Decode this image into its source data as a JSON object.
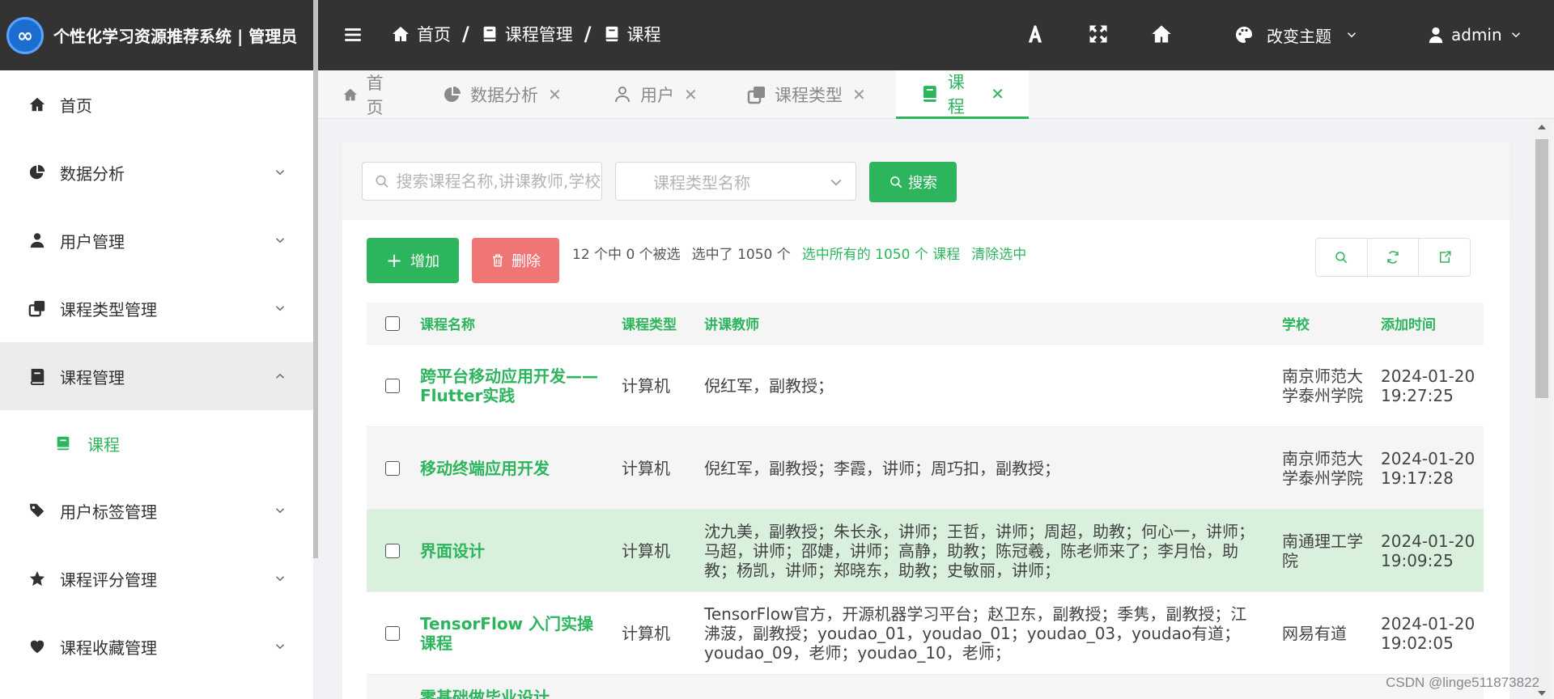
{
  "brand": {
    "title": "个性化学习资源推荐系统 | 管理员"
  },
  "sidebar": {
    "items": [
      {
        "label": "首页"
      },
      {
        "label": "数据分析"
      },
      {
        "label": "用户管理"
      },
      {
        "label": "课程类型管理"
      },
      {
        "label": "课程管理"
      },
      {
        "label": "课程"
      },
      {
        "label": "用户标签管理"
      },
      {
        "label": "课程评分管理"
      },
      {
        "label": "课程收藏管理"
      }
    ]
  },
  "header": {
    "breadcrumb": [
      "首页",
      "课程管理",
      "课程"
    ],
    "theme_label": "改变主题",
    "user_label": "admin"
  },
  "tabs": [
    {
      "label": "首页"
    },
    {
      "label": "数据分析"
    },
    {
      "label": "用户"
    },
    {
      "label": "课程类型"
    },
    {
      "label": "课程"
    }
  ],
  "filter": {
    "search_placeholder": "搜索课程名称,讲课教师,学校",
    "type_placeholder": "课程类型名称",
    "search_button": "搜索"
  },
  "toolbar": {
    "add_label": "增加",
    "delete_label": "删除",
    "selected_count": "12 个中 0 个被选",
    "selected_total": "选中了 1050 个",
    "select_all": "选中所有的 1050 个 课程",
    "clear_selection": "清除选中"
  },
  "table": {
    "headers": [
      "课程名称",
      "课程类型",
      "讲课教师",
      "学校",
      "添加时间"
    ],
    "rows": [
      {
        "name": "跨平台移动应用开发——Flutter实践",
        "type": "计算机",
        "teacher": "倪红军，副教授；",
        "school": "南京师范大学泰州学院",
        "time": "2024-01-20 19:27:25"
      },
      {
        "name": "移动终端应用开发",
        "type": "计算机",
        "teacher": "倪红军，副教授；李霞，讲师；周巧扣，副教授；",
        "school": "南京师范大学泰州学院",
        "time": "2024-01-20 19:17:28"
      },
      {
        "name": "界面设计",
        "type": "计算机",
        "teacher": "沈九美，副教授；朱长永，讲师；王哲，讲师；周超，助教；何心一，讲师；马超，讲师；邵婕，讲师；高静，助教；陈冠羲，陈老师来了；李月怡，助教；杨凯，讲师；郑晓东，助教；史敏丽，讲师；",
        "school": "南通理工学院",
        "time": "2024-01-20 19:09:25"
      },
      {
        "name": "TensorFlow 入门实操课程",
        "type": "计算机",
        "teacher": "TensorFlow官方，开源机器学习平台；赵卫东，副教授；季隽，副教授；江沸菠，副教授；youdao_01，youdao_01；youdao_03，youdao有道；youdao_09，老师；youdao_10，老师；",
        "school": "网易有道",
        "time": "2024-01-20 19:02:05"
      },
      {
        "name": "零基础做毕业设计",
        "type": "",
        "teacher": "",
        "school": "",
        "time": ""
      }
    ]
  },
  "watermark": "CSDN @linge511873822",
  "colors": {
    "accent": "#2db55d",
    "danger": "#f07575",
    "header_bg": "#333333",
    "row_hover": "#d9f0dd"
  }
}
